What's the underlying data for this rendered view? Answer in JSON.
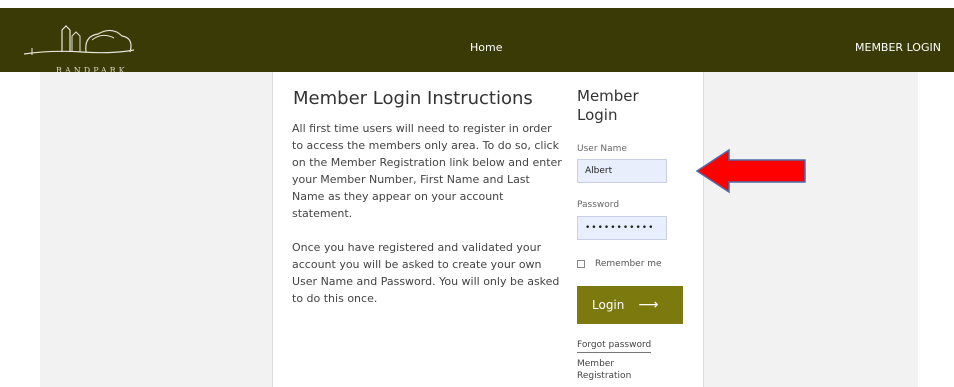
{
  "header": {
    "logo_text": "RANDPARK",
    "nav_home": "Home",
    "nav_member_login": "MEMBER LOGIN"
  },
  "instructions": {
    "title": "Member Login Instructions",
    "paragraph1": "All first time users will need to register in order to access the members only area. To do so, click on the Member Registration link below and enter your Member Number, First Name and Last Name as they appear on your account statement.",
    "paragraph2": "Once you have registered and validated your account you will be asked to create your own User Name and Password. You will only be asked to do this once."
  },
  "login": {
    "title": "Member Login",
    "username_label": "User Name",
    "username_value": "Albert",
    "password_label": "Password",
    "password_value": "•••••••••••",
    "remember_label": "Remember me",
    "login_button": "Login",
    "login_arrow": "⟶",
    "forgot_link": "Forgot password",
    "registration_link": "Member Registration"
  },
  "colors": {
    "header_bg": "#3a3a06",
    "button_bg": "#7c7a0f",
    "input_bg": "#e8eefb",
    "annotation_arrow": "#ff0000"
  },
  "icons": {
    "logo": "randpark-logo-icon",
    "annotation": "red-arrow-icon"
  }
}
